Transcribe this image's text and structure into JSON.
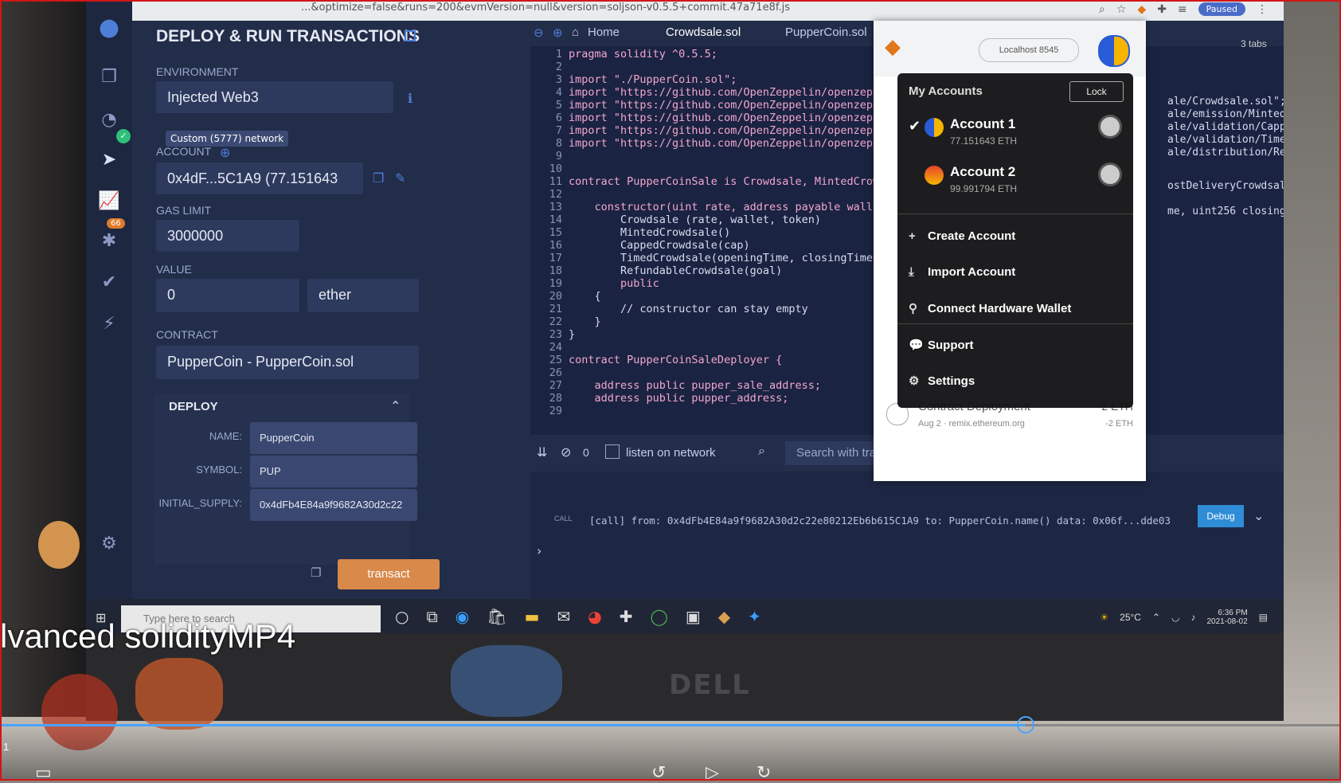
{
  "browser": {
    "url": "...&optimize=false&runs=200&evmVersion=null&version=soljson-v0.5.5+commit.47a71e8f.js",
    "paused": "Paused"
  },
  "panel": {
    "title": "DEPLOY & RUN TRANSACTIONS",
    "environment_label": "ENVIRONMENT",
    "environment_value": "Injected Web3",
    "network_tag": "Custom (5777) network",
    "account_label": "ACCOUNT",
    "account_value": "0x4dF...5C1A9 (77.151643",
    "gas_limit_label": "GAS LIMIT",
    "gas_limit_value": "3000000",
    "value_label": "VALUE",
    "value_amount": "0",
    "value_unit": "ether",
    "contract_label": "CONTRACT",
    "contract_value": "PupperCoin - PupperCoin.sol",
    "deploy_label": "DEPLOY",
    "fields": [
      {
        "label": "NAME:",
        "value": "PupperCoin"
      },
      {
        "label": "SYMBOL:",
        "value": "PUP"
      },
      {
        "label": "INITIAL_SUPPLY:",
        "value": "0x4dFb4E84a9f9682A30d2c22"
      }
    ],
    "transact": "transact",
    "badge_count": "66"
  },
  "editor": {
    "tabs": [
      "Home",
      "Crowdsale.sol",
      "PupperCoin.sol"
    ],
    "lines": [
      {
        "n": "1",
        "code": "pragma solidity ^0.5.5;"
      },
      {
        "n": "2",
        "code": ""
      },
      {
        "n": "3",
        "code": "import \"./PupperCoin.sol\";"
      },
      {
        "n": "4",
        "code": "import \"https://github.com/OpenZeppelin/openzeppelin-cor"
      },
      {
        "n": "5",
        "code": "import \"https://github.com/OpenZeppelin/openzeppelin-cor"
      },
      {
        "n": "6",
        "code": "import \"https://github.com/OpenZeppelin/openzeppelin-cor"
      },
      {
        "n": "7",
        "code": "import \"https://github.com/OpenZeppelin/openzeppelin-cor"
      },
      {
        "n": "8",
        "code": "import \"https://github.com/OpenZeppelin/openzeppelin-cor"
      },
      {
        "n": "9",
        "code": ""
      },
      {
        "n": "10",
        "code": ""
      },
      {
        "n": "11",
        "code": "contract PupperCoinSale is Crowdsale, MintedCrowdsale, C"
      },
      {
        "n": "12",
        "code": ""
      },
      {
        "n": "13",
        "code": "    constructor(uint rate, address payable wallet, Puppe"
      },
      {
        "n": "14",
        "code": "        Crowdsale (rate, wallet, token)"
      },
      {
        "n": "15",
        "code": "        MintedCrowdsale()"
      },
      {
        "n": "16",
        "code": "        CappedCrowdsale(cap)"
      },
      {
        "n": "17",
        "code": "        TimedCrowdsale(openingTime, closingTime)"
      },
      {
        "n": "18",
        "code": "        RefundableCrowdsale(goal)"
      },
      {
        "n": "19",
        "code": "        public"
      },
      {
        "n": "20",
        "code": "    {"
      },
      {
        "n": "21",
        "code": "        // constructor can stay empty"
      },
      {
        "n": "22",
        "code": "    }"
      },
      {
        "n": "23",
        "code": "}"
      },
      {
        "n": "24",
        "code": ""
      },
      {
        "n": "25",
        "code": "contract PupperCoinSaleDeployer {"
      },
      {
        "n": "26",
        "code": ""
      },
      {
        "n": "27",
        "code": "    address public pupper_sale_address;"
      },
      {
        "n": "28",
        "code": "    address public pupper_address;"
      },
      {
        "n": "29",
        "code": ""
      }
    ],
    "overflow_right": [
      "ale/Crowdsale.sol\";",
      "ale/emission/MintedCr",
      "ale/validation/Capped",
      "ale/validation/TimedC",
      "ale/distribution/Refu",
      "ostDeliveryCrowdsale",
      "me, uint256 closingTi"
    ]
  },
  "terminal": {
    "count": "0",
    "listen": "listen on network",
    "search_placeholder": "Search with transaction hash or address",
    "log": "[call] from: 0x4dFb4E84a9f9682A30d2c22e80212Eb6b615C1A9 to: PupperCoin.name() data: 0x06f...dde03",
    "call_tag": "CALL",
    "debug": "Debug"
  },
  "metamask": {
    "network": "Localhost 8545",
    "tabs_count": "3 tabs",
    "my_accounts": "My Accounts",
    "lock": "Lock",
    "accounts": [
      {
        "name": "Account 1",
        "balance": "77.151643 ETH",
        "selected": true
      },
      {
        "name": "Account 2",
        "balance": "99.991794 ETH",
        "selected": false
      }
    ],
    "menu": [
      {
        "label": "Create Account",
        "icon": "plus-icon"
      },
      {
        "label": "Import Account",
        "icon": "download-icon"
      },
      {
        "label": "Connect Hardware Wallet",
        "icon": "usb-icon"
      },
      {
        "label": "Support",
        "icon": "chat-icon"
      },
      {
        "label": "Settings",
        "icon": "gear-icon"
      }
    ],
    "tx": {
      "title": "Contract Deployment",
      "date": "Aug 2 · remix.ethereum.org",
      "amount": "-2 ETH",
      "amount2": "-2 ETH"
    }
  },
  "taskbar": {
    "search": "Type here to search",
    "temp": "25°C",
    "time": "6:36 PM",
    "date": "2021-08-02"
  },
  "video": {
    "caption": "lvanced solidityMP4",
    "timecode": "1",
    "progress_fraction": 0.765
  }
}
